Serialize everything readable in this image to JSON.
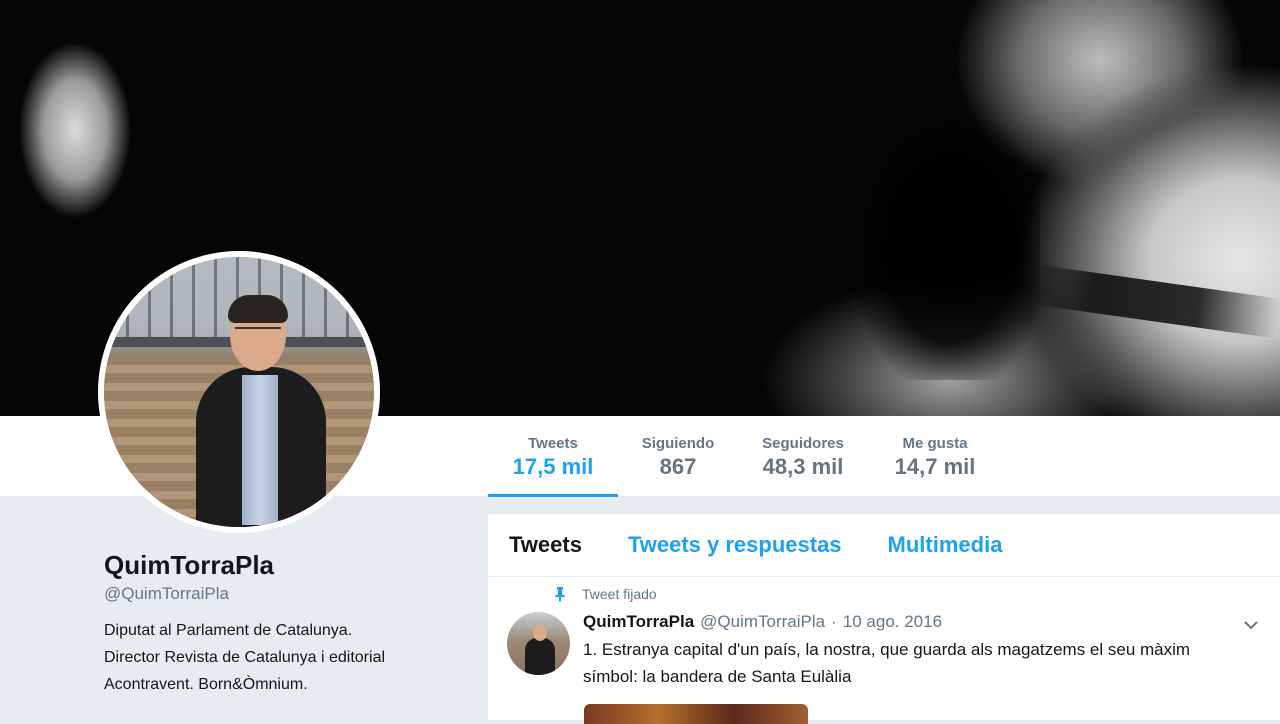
{
  "stats": [
    {
      "label": "Tweets",
      "value": "17,5 mil"
    },
    {
      "label": "Siguiendo",
      "value": "867"
    },
    {
      "label": "Seguidores",
      "value": "48,3 mil"
    },
    {
      "label": "Me gusta",
      "value": "14,7 mil"
    }
  ],
  "profile": {
    "name": "QuimTorraPla",
    "handle": "@QuimTorraiPla",
    "bio_lines": [
      "Diputat al Parlament de Catalunya.",
      "Director Revista de Catalunya i editorial",
      "Acontravent. Born&Òmnium."
    ]
  },
  "tabs": [
    {
      "label": "Tweets"
    },
    {
      "label": "Tweets y respuestas"
    },
    {
      "label": "Multimedia"
    }
  ],
  "tweet": {
    "pinned_label": "Tweet fijado",
    "name": "QuimTorraPla",
    "handle": "@QuimTorraiPla",
    "separator": "·",
    "date": "10 ago. 2016",
    "text": "1. Estranya capital d'un país, la nostra, que guarda als magatzems el seu màxim símbol: la bandera de Santa Eulàlia"
  },
  "colors": {
    "accent": "#1da1f2",
    "text_primary": "#14171a",
    "text_secondary": "#657786",
    "background": "#e6ecf0"
  },
  "icons": {
    "pin": "pin-icon",
    "caret": "chevron-down-icon"
  }
}
